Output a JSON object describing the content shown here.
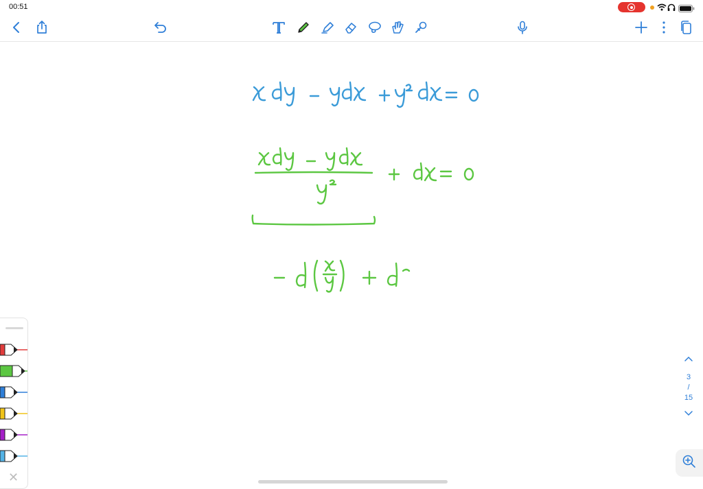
{
  "status": {
    "time": "00:51"
  },
  "toolbar": {
    "left": [
      "back-icon",
      "share-icon",
      "undo-icon"
    ],
    "tools": [
      "text-tool-icon",
      "pen-tool-icon",
      "highlighter-tool-icon",
      "eraser-tool-icon",
      "lasso-tool-icon",
      "shape-tool-icon",
      "laser-pointer-icon"
    ],
    "right": [
      "microphone-icon",
      "add-icon",
      "more-icon",
      "pages-icon"
    ]
  },
  "colors": {
    "accent": "#2f7fd8",
    "ink_blue": "#3b9bd8",
    "ink_green": "#5cc742",
    "record": "#e5342e"
  },
  "pens": [
    {
      "name": "red",
      "color": "#e23c3c"
    },
    {
      "name": "green",
      "color": "#5cc742"
    },
    {
      "name": "blue",
      "color": "#2f7fd8"
    },
    {
      "name": "yellow",
      "color": "#f0c419"
    },
    {
      "name": "purple",
      "color": "#a520c8"
    },
    {
      "name": "light-blue",
      "color": "#54b3e6"
    }
  ],
  "pager": {
    "current": "3",
    "separator": "/",
    "total": "15"
  }
}
